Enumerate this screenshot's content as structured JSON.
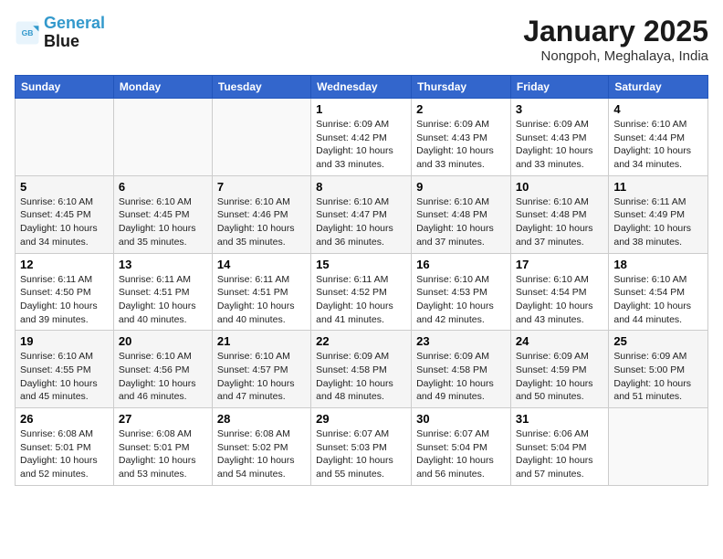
{
  "logo": {
    "line1": "General",
    "line2": "Blue"
  },
  "header": {
    "title": "January 2025",
    "subtitle": "Nongpoh, Meghalaya, India"
  },
  "weekdays": [
    "Sunday",
    "Monday",
    "Tuesday",
    "Wednesday",
    "Thursday",
    "Friday",
    "Saturday"
  ],
  "weeks": [
    [
      {
        "day": "",
        "info": ""
      },
      {
        "day": "",
        "info": ""
      },
      {
        "day": "",
        "info": ""
      },
      {
        "day": "1",
        "info": "Sunrise: 6:09 AM\nSunset: 4:42 PM\nDaylight: 10 hours\nand 33 minutes."
      },
      {
        "day": "2",
        "info": "Sunrise: 6:09 AM\nSunset: 4:43 PM\nDaylight: 10 hours\nand 33 minutes."
      },
      {
        "day": "3",
        "info": "Sunrise: 6:09 AM\nSunset: 4:43 PM\nDaylight: 10 hours\nand 33 minutes."
      },
      {
        "day": "4",
        "info": "Sunrise: 6:10 AM\nSunset: 4:44 PM\nDaylight: 10 hours\nand 34 minutes."
      }
    ],
    [
      {
        "day": "5",
        "info": "Sunrise: 6:10 AM\nSunset: 4:45 PM\nDaylight: 10 hours\nand 34 minutes."
      },
      {
        "day": "6",
        "info": "Sunrise: 6:10 AM\nSunset: 4:45 PM\nDaylight: 10 hours\nand 35 minutes."
      },
      {
        "day": "7",
        "info": "Sunrise: 6:10 AM\nSunset: 4:46 PM\nDaylight: 10 hours\nand 35 minutes."
      },
      {
        "day": "8",
        "info": "Sunrise: 6:10 AM\nSunset: 4:47 PM\nDaylight: 10 hours\nand 36 minutes."
      },
      {
        "day": "9",
        "info": "Sunrise: 6:10 AM\nSunset: 4:48 PM\nDaylight: 10 hours\nand 37 minutes."
      },
      {
        "day": "10",
        "info": "Sunrise: 6:10 AM\nSunset: 4:48 PM\nDaylight: 10 hours\nand 37 minutes."
      },
      {
        "day": "11",
        "info": "Sunrise: 6:11 AM\nSunset: 4:49 PM\nDaylight: 10 hours\nand 38 minutes."
      }
    ],
    [
      {
        "day": "12",
        "info": "Sunrise: 6:11 AM\nSunset: 4:50 PM\nDaylight: 10 hours\nand 39 minutes."
      },
      {
        "day": "13",
        "info": "Sunrise: 6:11 AM\nSunset: 4:51 PM\nDaylight: 10 hours\nand 40 minutes."
      },
      {
        "day": "14",
        "info": "Sunrise: 6:11 AM\nSunset: 4:51 PM\nDaylight: 10 hours\nand 40 minutes."
      },
      {
        "day": "15",
        "info": "Sunrise: 6:11 AM\nSunset: 4:52 PM\nDaylight: 10 hours\nand 41 minutes."
      },
      {
        "day": "16",
        "info": "Sunrise: 6:10 AM\nSunset: 4:53 PM\nDaylight: 10 hours\nand 42 minutes."
      },
      {
        "day": "17",
        "info": "Sunrise: 6:10 AM\nSunset: 4:54 PM\nDaylight: 10 hours\nand 43 minutes."
      },
      {
        "day": "18",
        "info": "Sunrise: 6:10 AM\nSunset: 4:54 PM\nDaylight: 10 hours\nand 44 minutes."
      }
    ],
    [
      {
        "day": "19",
        "info": "Sunrise: 6:10 AM\nSunset: 4:55 PM\nDaylight: 10 hours\nand 45 minutes."
      },
      {
        "day": "20",
        "info": "Sunrise: 6:10 AM\nSunset: 4:56 PM\nDaylight: 10 hours\nand 46 minutes."
      },
      {
        "day": "21",
        "info": "Sunrise: 6:10 AM\nSunset: 4:57 PM\nDaylight: 10 hours\nand 47 minutes."
      },
      {
        "day": "22",
        "info": "Sunrise: 6:09 AM\nSunset: 4:58 PM\nDaylight: 10 hours\nand 48 minutes."
      },
      {
        "day": "23",
        "info": "Sunrise: 6:09 AM\nSunset: 4:58 PM\nDaylight: 10 hours\nand 49 minutes."
      },
      {
        "day": "24",
        "info": "Sunrise: 6:09 AM\nSunset: 4:59 PM\nDaylight: 10 hours\nand 50 minutes."
      },
      {
        "day": "25",
        "info": "Sunrise: 6:09 AM\nSunset: 5:00 PM\nDaylight: 10 hours\nand 51 minutes."
      }
    ],
    [
      {
        "day": "26",
        "info": "Sunrise: 6:08 AM\nSunset: 5:01 PM\nDaylight: 10 hours\nand 52 minutes."
      },
      {
        "day": "27",
        "info": "Sunrise: 6:08 AM\nSunset: 5:01 PM\nDaylight: 10 hours\nand 53 minutes."
      },
      {
        "day": "28",
        "info": "Sunrise: 6:08 AM\nSunset: 5:02 PM\nDaylight: 10 hours\nand 54 minutes."
      },
      {
        "day": "29",
        "info": "Sunrise: 6:07 AM\nSunset: 5:03 PM\nDaylight: 10 hours\nand 55 minutes."
      },
      {
        "day": "30",
        "info": "Sunrise: 6:07 AM\nSunset: 5:04 PM\nDaylight: 10 hours\nand 56 minutes."
      },
      {
        "day": "31",
        "info": "Sunrise: 6:06 AM\nSunset: 5:04 PM\nDaylight: 10 hours\nand 57 minutes."
      },
      {
        "day": "",
        "info": ""
      }
    ]
  ]
}
